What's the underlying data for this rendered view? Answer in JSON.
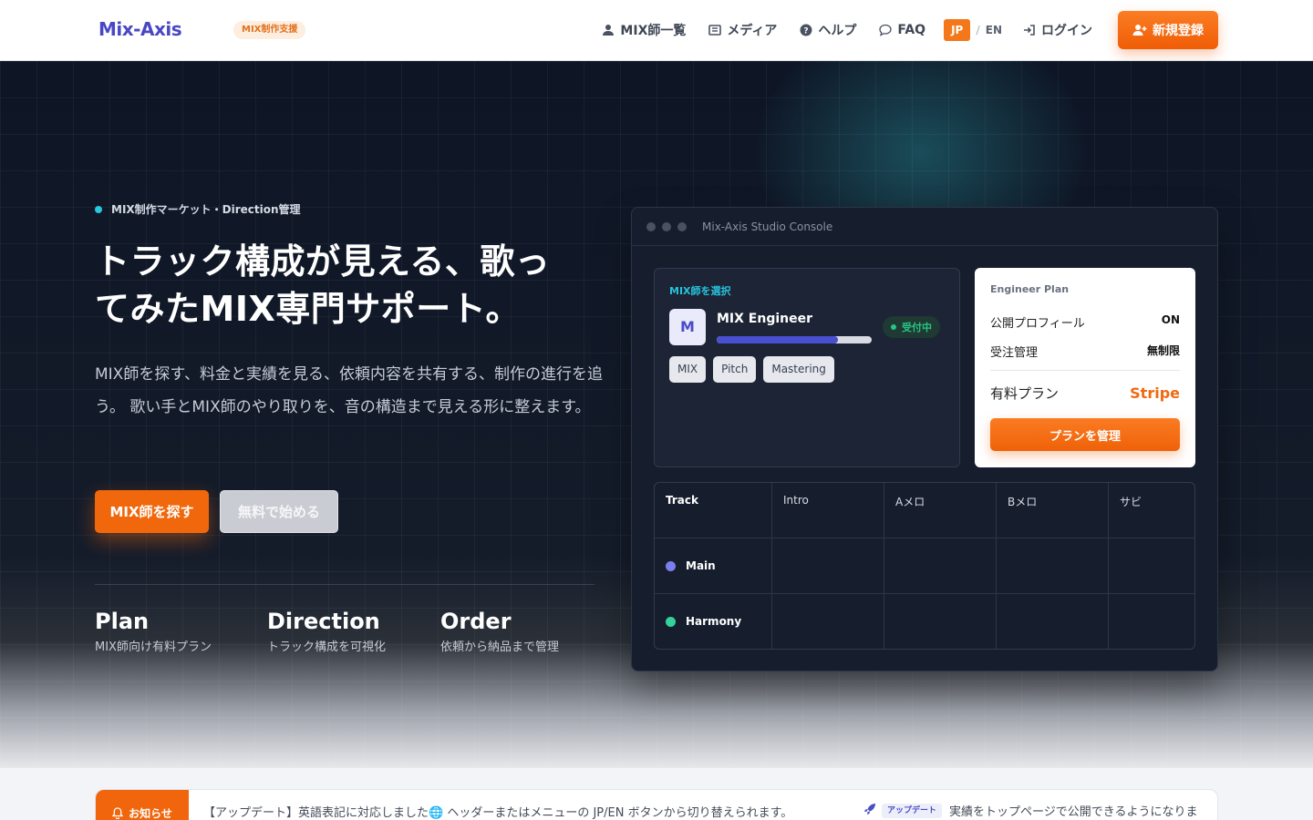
{
  "header": {
    "logo": "Mix-Axis",
    "logo_badge": "MIX制作支援",
    "nav": [
      {
        "label": "MIX師一覧",
        "icon": "user-icon"
      },
      {
        "label": "メディア",
        "icon": "book-icon"
      },
      {
        "label": "ヘルプ",
        "icon": "help-circle-icon"
      },
      {
        "label": "FAQ",
        "icon": "chat-bubble-icon"
      }
    ],
    "lang": {
      "jp": "JP",
      "sep": "/",
      "en": "EN"
    },
    "login": "ログイン",
    "signup": "新規登録"
  },
  "hero": {
    "eyebrow": "MIX制作マーケット・Direction管理",
    "headline": "トラック構成が見える、歌ってみたMIX専門サポート。",
    "lead": "MIX師を探す、料金と実績を見る、依頼内容を共有する、制作の進行を追う。 歌い手とMIX師のやり取りを、音の構造まで見える形に整えます。",
    "primary_button": "MIX師を探す",
    "secondary_button": "無料で始める",
    "stats": [
      {
        "title": "Plan",
        "sub": "MIX師向け有料プラン"
      },
      {
        "title": "Direction",
        "sub": "トラック構成を可視化"
      },
      {
        "title": "Order",
        "sub": "依頼から納品まで管理"
      }
    ]
  },
  "console": {
    "title": "Mix-Axis Studio Console",
    "select": {
      "title": "MIX師を選択",
      "avatar_letter": "M",
      "engineer_name": "MIX Engineer",
      "progress": 0.78,
      "status": "受付中",
      "tags": [
        "MIX",
        "Pitch",
        "Mastering"
      ]
    },
    "plan": {
      "title": "Engineer Plan",
      "rows": [
        {
          "key": "公開プロフィール",
          "value": "ON"
        },
        {
          "key": "受注管理",
          "value": "無制限"
        }
      ],
      "paid_key": "有料プラン",
      "paid_value": "Stripe",
      "button": "プランを管理"
    },
    "tracks": {
      "columns": [
        "Track",
        "Intro",
        "Aメロ",
        "Bメロ",
        "サビ"
      ],
      "rows": [
        {
          "name": "Main",
          "color": "#7b7ef0"
        },
        {
          "name": "Harmony",
          "color": "#33d29a"
        }
      ]
    }
  },
  "notice": {
    "label": "お知らせ",
    "text": "【アップデート】英語表記に対応しました🌐 ヘッダーまたはメニューの JP/EN ボタンから切り替えられます。",
    "second_badge": "アップデート",
    "second_text": "実績をトップページで公開できるようになりま"
  }
}
